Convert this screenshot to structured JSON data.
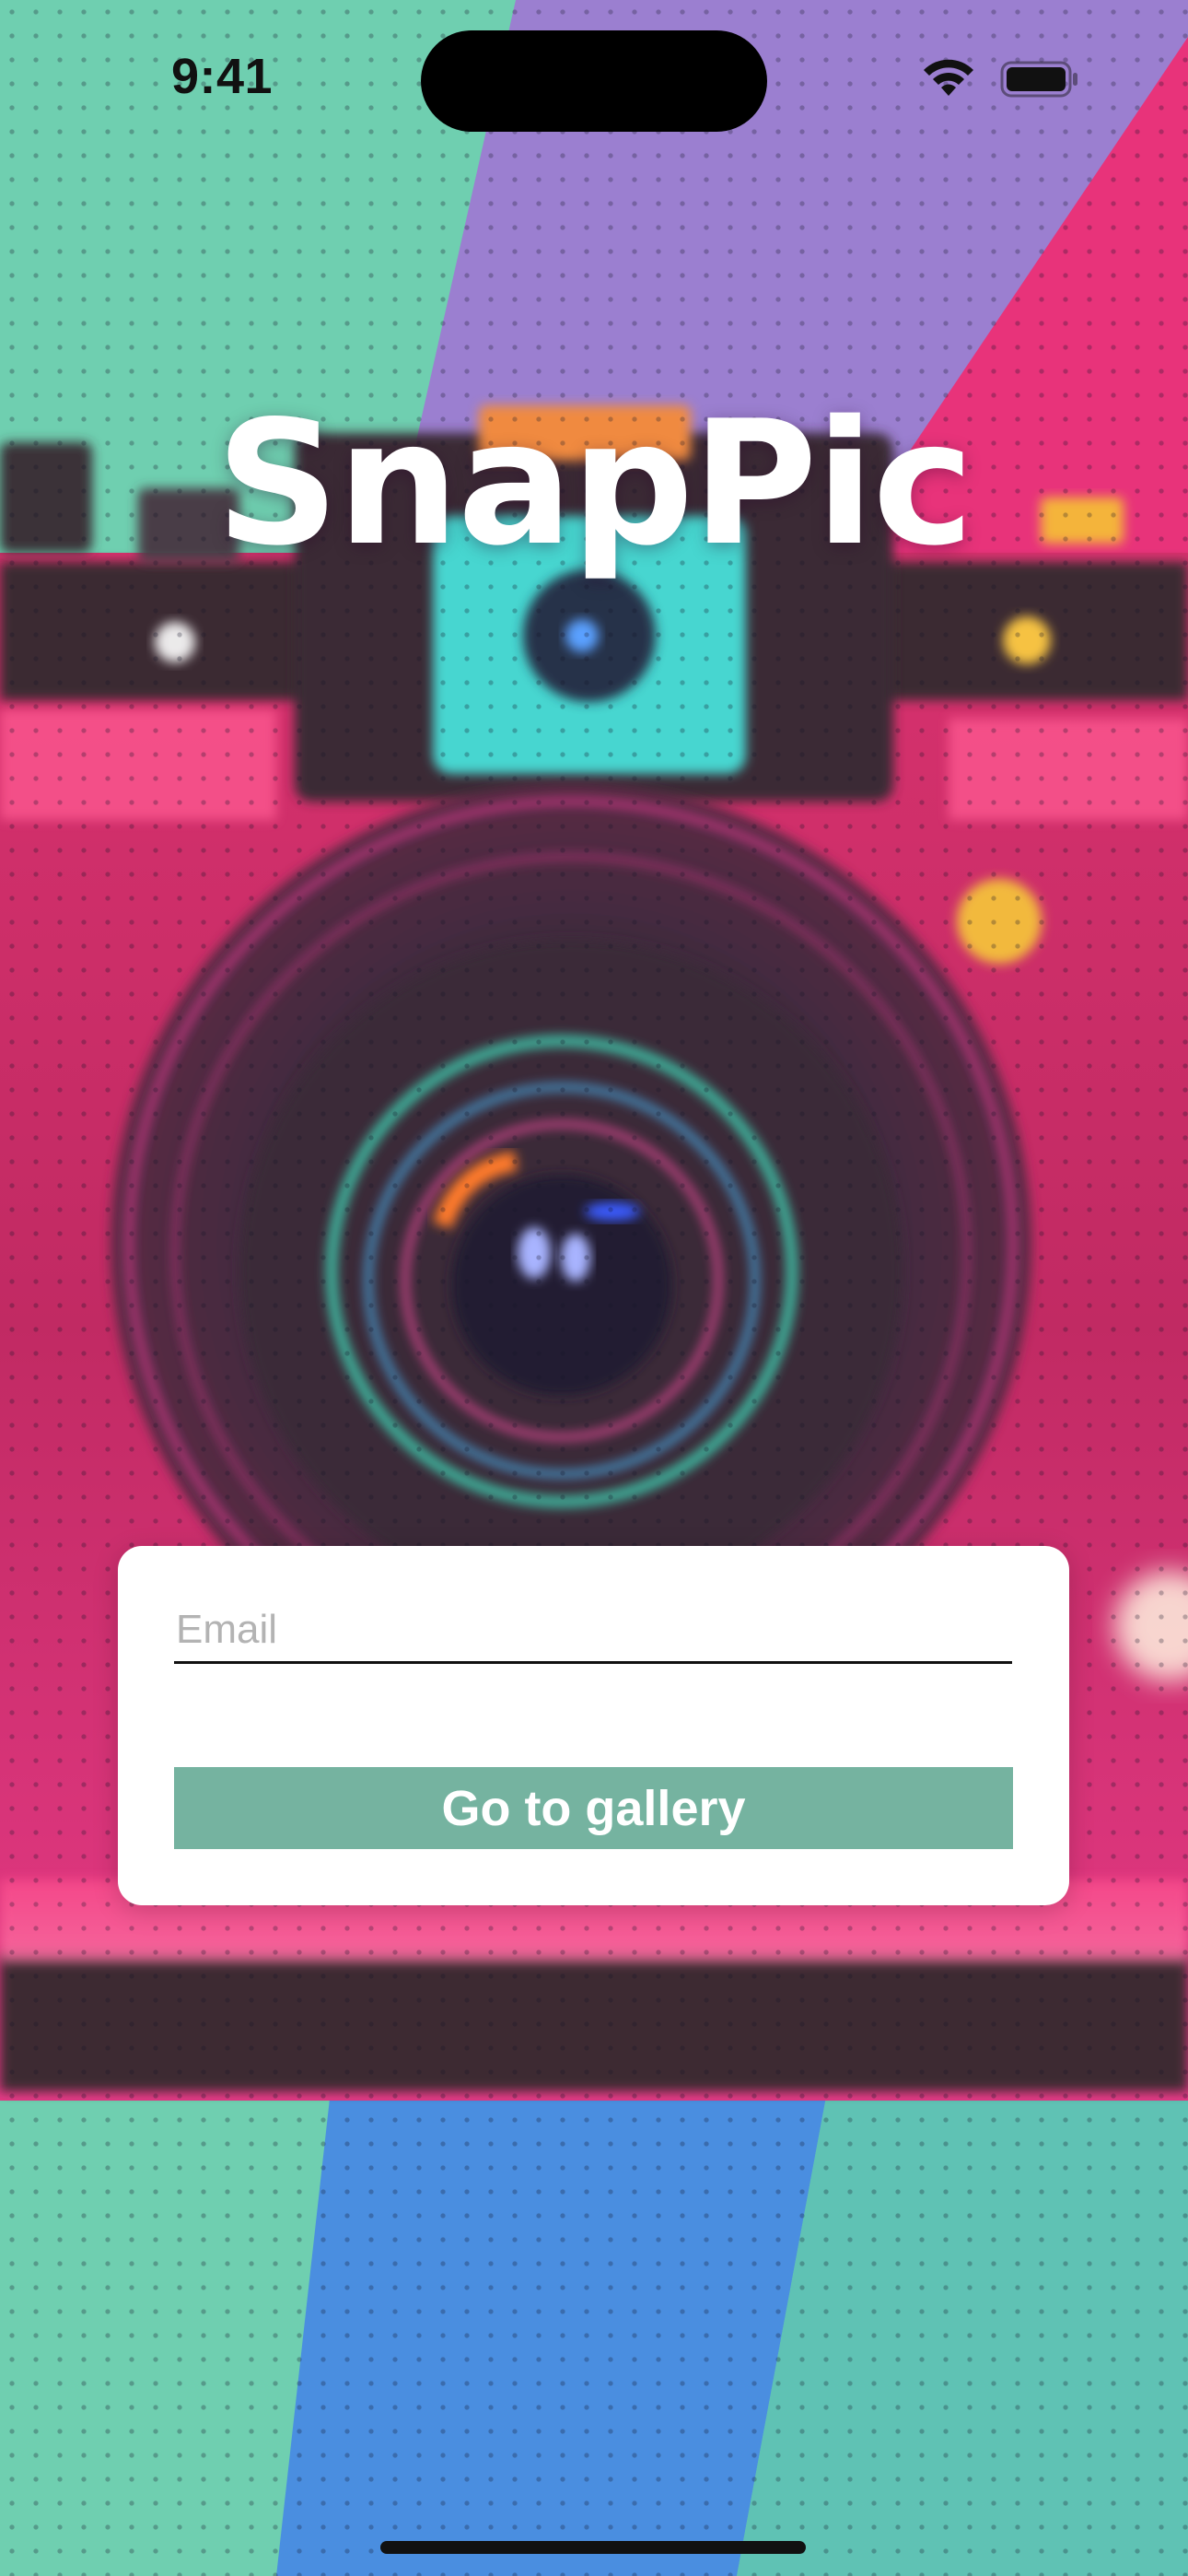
{
  "status_bar": {
    "time": "9:41",
    "wifi_icon": "wifi-icon",
    "battery_icon": "battery-icon"
  },
  "app": {
    "logo_text": "SnapPic",
    "background_image": "retro-camera-illustration"
  },
  "login_form": {
    "email_placeholder": "Email",
    "email_value": "",
    "submit_label": "Go to gallery"
  },
  "colors": {
    "button_background": "#75b3a0",
    "button_text": "#ffffff",
    "card_background": "#ffffff",
    "logo_text": "#ffffff",
    "teal": "#6fcfb0",
    "purple": "#9b7fd0",
    "magenta": "#e8337a",
    "blue": "#4a8ee0"
  }
}
